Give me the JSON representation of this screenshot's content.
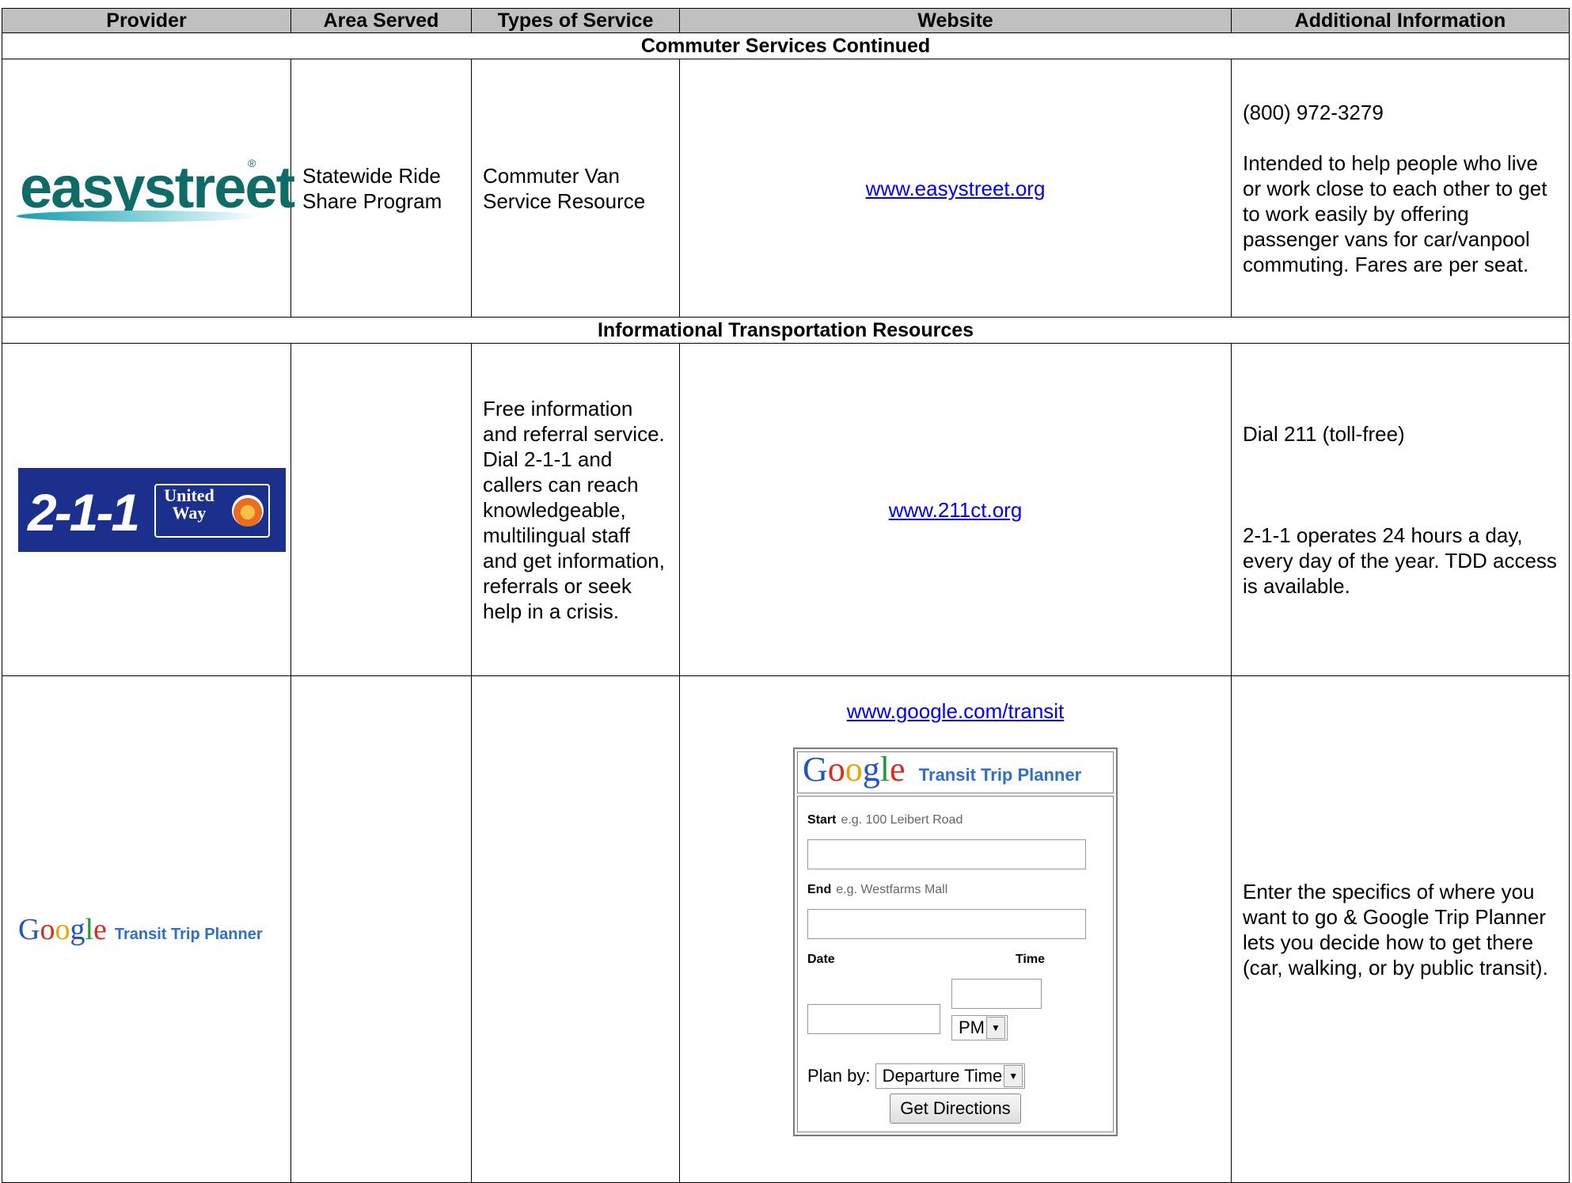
{
  "headers": [
    "Provider",
    "Area Served",
    "Types of Service",
    "Website",
    "Additional Information"
  ],
  "section1": "Commuter Services Continued",
  "section2": "Informational Transportation Resources",
  "row_easystreet": {
    "logo_text": "easystreet",
    "logo_mark": "®",
    "area": "Statewide Ride Share Program",
    "service": "Commuter Van Service Resource",
    "website": "www.easystreet.org",
    "phone": "(800) 972-3279",
    "info": "Intended to help people who live or work close to each other to get to work easily by offering passenger vans for car/vanpool commuting. Fares are per seat."
  },
  "row_211": {
    "logo_number": "2-1-1",
    "logo_org": "United Way",
    "service": "Free information and referral service. Dial 2-1-1 and callers can reach knowledgeable, multilingual staff and get information, referrals or seek help in a crisis.",
    "website": "www.211ct.org",
    "info1": "Dial 211 (toll-free)",
    "info2": "2-1-1 operates 24 hours a day, every day of the year. TDD access is available."
  },
  "row_google": {
    "logo_letters": [
      "G",
      "o",
      "o",
      "g",
      "l",
      "e"
    ],
    "logo_sub": "Transit Trip Planner",
    "website": "www.google.com/transit",
    "info": "Enter the specifics of where you want to go & Google Trip Planner lets you decide how to get there (car, walking, or by public transit).",
    "planner": {
      "start_label": "Start",
      "start_hint": "e.g. 100 Leibert Road",
      "end_label": "End",
      "end_hint": "e.g. Westfarms Mall",
      "date_label": "Date",
      "time_label": "Time",
      "ampm": "PM",
      "plan_by_label": "Plan by:",
      "plan_by_value": "Departure Time",
      "button": "Get Directions"
    }
  },
  "colors": {
    "header_bg": "#c0c0c0",
    "link": "#0000ee",
    "logo211_bg": "#1b2f8c",
    "easy_green": "#0e6b68"
  }
}
